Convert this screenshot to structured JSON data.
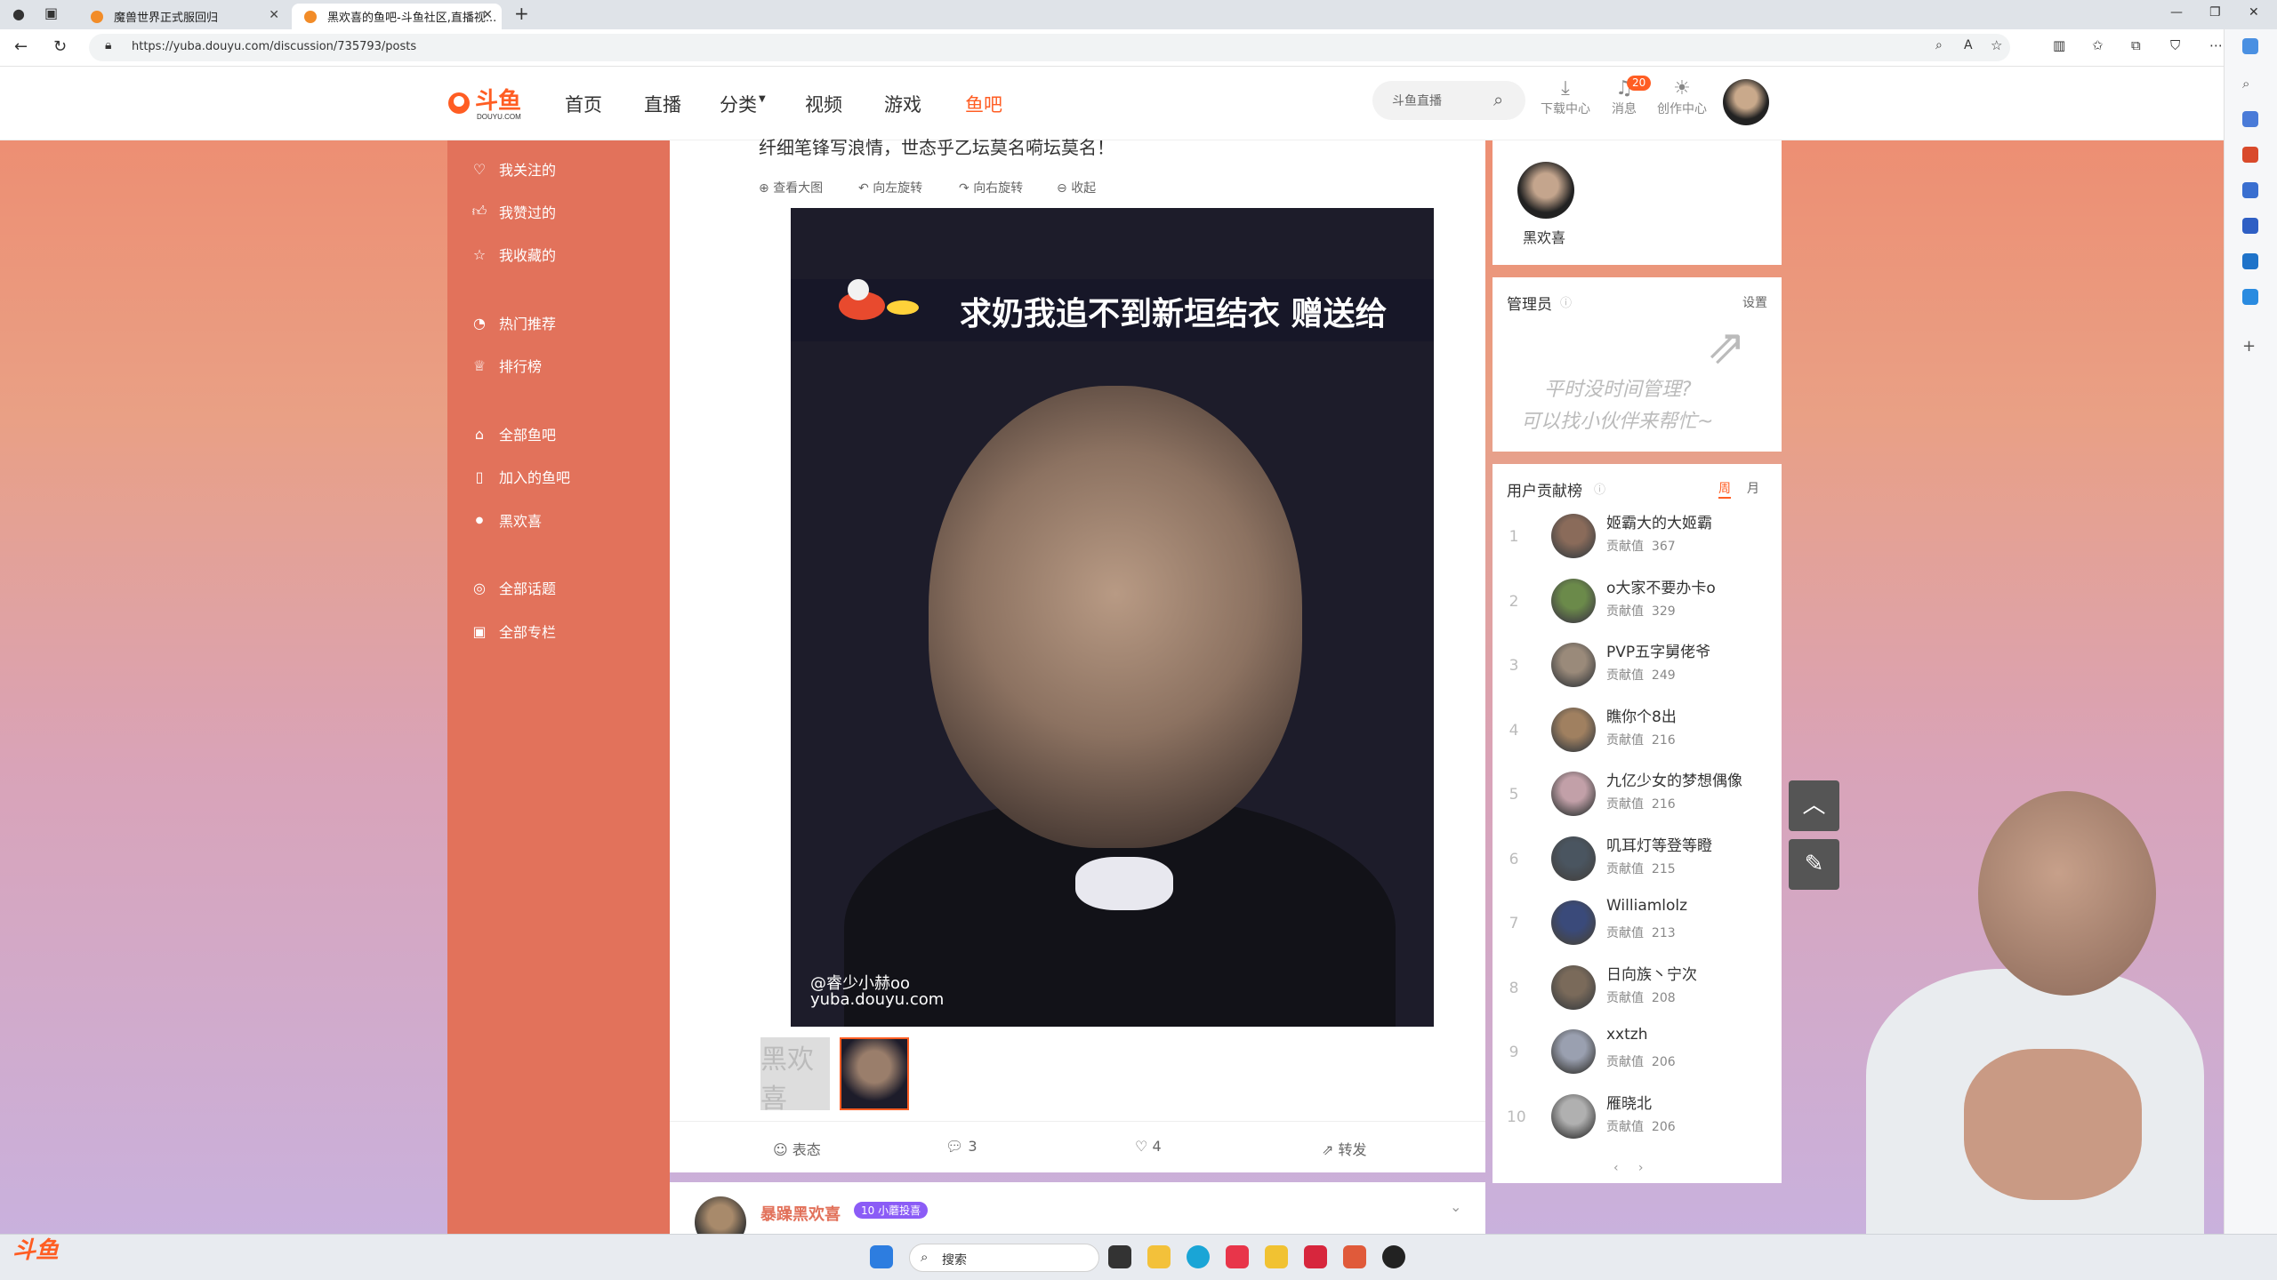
{
  "browser": {
    "tabs": [
      {
        "title": "魔兽世界正式服回归"
      },
      {
        "title": "黑欢喜的鱼吧-斗鱼社区,直播视..."
      }
    ],
    "url": "https://yuba.douyu.com/discussion/735793/posts"
  },
  "header": {
    "logo": "斗鱼",
    "logo_sub": "DOUYU.COM",
    "nav": [
      "首页",
      "直播",
      "分类",
      "视频",
      "游戏",
      "鱼吧"
    ],
    "search_placeholder": "斗鱼直播",
    "icons": [
      {
        "label": "下载中心",
        "icon": "download-icon"
      },
      {
        "label": "消息",
        "icon": "bell-icon"
      },
      {
        "label": "创作中心",
        "icon": "bulb-icon"
      }
    ],
    "message_count": "20"
  },
  "left_nav": {
    "items": [
      "我关注的",
      "我赞过的",
      "我收藏的",
      "热门推荐",
      "排行榜",
      "全部鱼吧",
      "加入的鱼吧",
      "黑欢喜",
      "全部话题",
      "全部专栏"
    ]
  },
  "post": {
    "title_cut": "纤细笔锋写浪情，世态乎乙坛莫名嗬坛莫名！",
    "tools": [
      "查看大图",
      "向左旋转",
      "向右旋转",
      "收起"
    ],
    "image_caption": "求奶我追不到新垣结衣 赠送给",
    "watermark_1": "@睿少小赫oo",
    "watermark_2": "yuba.douyu.com",
    "thumb1_text": "黑欢喜",
    "actions": {
      "react": "表态",
      "comments": "3",
      "likes": "4",
      "share": "转发"
    }
  },
  "reply": {
    "name": "暴躁黑欢喜",
    "badge": "10 小蘑投喜"
  },
  "right": {
    "host_name": "黑欢喜",
    "admin_title": "管理员",
    "admin_settings": "设置",
    "admin_line1": "平时没时间管理?",
    "admin_line2": "可以找小伙伴来帮忙~",
    "rank_title": "用户贡献榜",
    "rank_tabs": [
      "周",
      "月"
    ],
    "score_label": "贡献值",
    "ranks": [
      {
        "num": "1",
        "name": "姬霸大的大姬霸",
        "score": "367"
      },
      {
        "num": "2",
        "name": "o大家不要办卡o",
        "score": "329"
      },
      {
        "num": "3",
        "name": "PVP五字舅佬爷",
        "score": "249"
      },
      {
        "num": "4",
        "name": "瞧你个8出",
        "score": "216"
      },
      {
        "num": "5",
        "name": "九亿少女的梦想偶像",
        "score": "216"
      },
      {
        "num": "6",
        "name": "叽耳灯等登等瞪",
        "score": "215"
      },
      {
        "num": "7",
        "name": "Williamlolz",
        "score": "213"
      },
      {
        "num": "8",
        "name": "日向族丶宁次",
        "score": "208"
      },
      {
        "num": "9",
        "name": "xxtzh",
        "score": "206"
      },
      {
        "num": "10",
        "name": "雁晓北",
        "score": "206"
      }
    ]
  },
  "taskbar": {
    "search_placeholder": "搜索"
  },
  "colors": {
    "accent": "#ff5d23",
    "sidebar": "#e2725b"
  }
}
